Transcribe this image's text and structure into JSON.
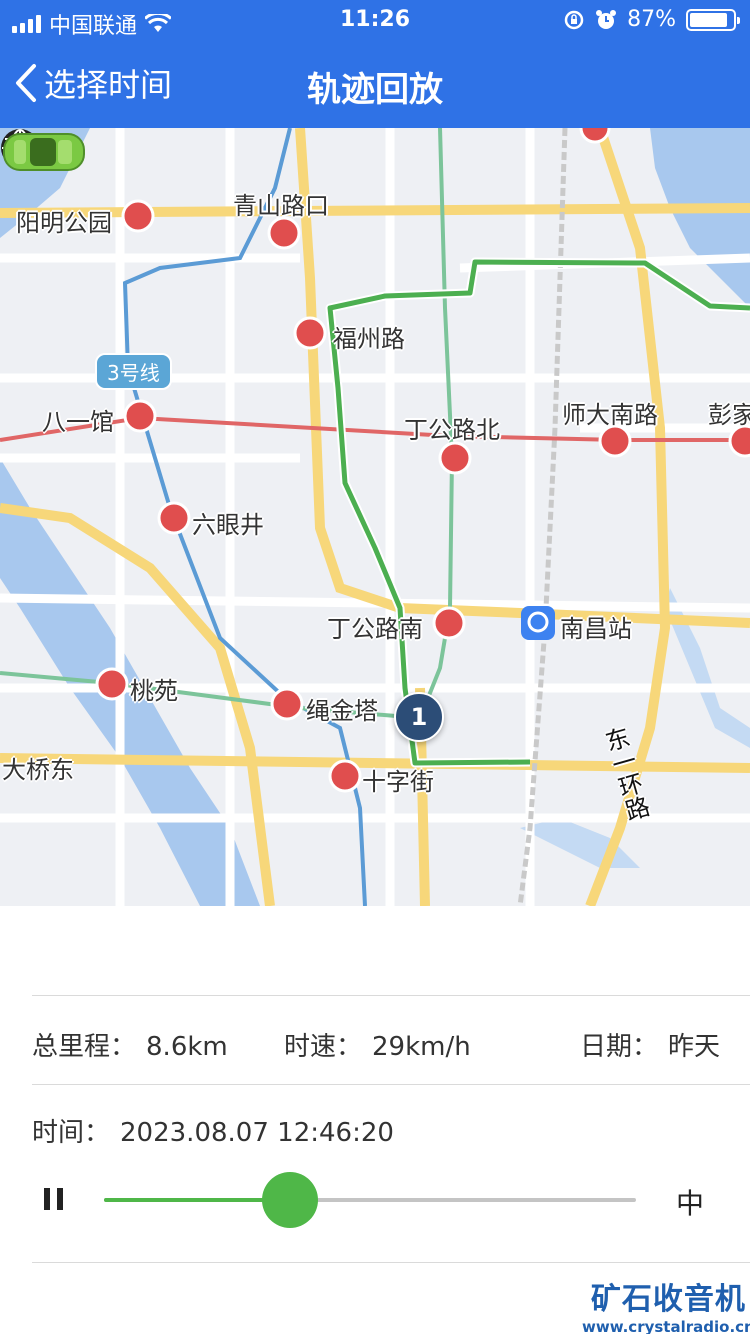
{
  "status_bar": {
    "carrier": "中国联通",
    "time": "11:26",
    "battery": "87%",
    "battery_level": 0.87
  },
  "nav": {
    "back_label": "选择时间",
    "title": "轨迹回放"
  },
  "map": {
    "labels": {
      "qingshan": "青山路口",
      "yangming": "阳明公园",
      "fuzhou": "福州路",
      "bayiguan": "八一馆",
      "dinggongbei": "丁公路北",
      "shidanan": "师大南路",
      "peng": "彭家",
      "liuyan": "六眼井",
      "dinggongnan": "丁公路南",
      "nanchang": "南昌站",
      "taoyuan": "桃苑",
      "shengjinta": "绳金塔",
      "daqiaodong": "大桥东",
      "shizijie": "十字街",
      "dongyihuan": "东一环路"
    },
    "line_badge": "3号线",
    "marker_number": "1",
    "colors": {
      "track": "#4caf50",
      "metro_red": "#e06666",
      "metro_blue": "#5b9bd5",
      "metro_green": "#7cc49a",
      "major_road": "#f7d77a",
      "water": "#a8c8ee",
      "station": "#e04e4e"
    }
  },
  "info": {
    "mileage_label": "总里程：",
    "mileage_value": "8.6km",
    "speed_label": "时速：",
    "speed_value": "29km/h",
    "date_label": "日期：",
    "date_value": "昨天",
    "time_label": "时间：",
    "time_value": "2023.08.07 12:46:20",
    "playback_progress": 0.35,
    "speed_mode": "中"
  },
  "watermark": {
    "title": "矿石收音机",
    "url": "www.crystalradio.cn"
  }
}
